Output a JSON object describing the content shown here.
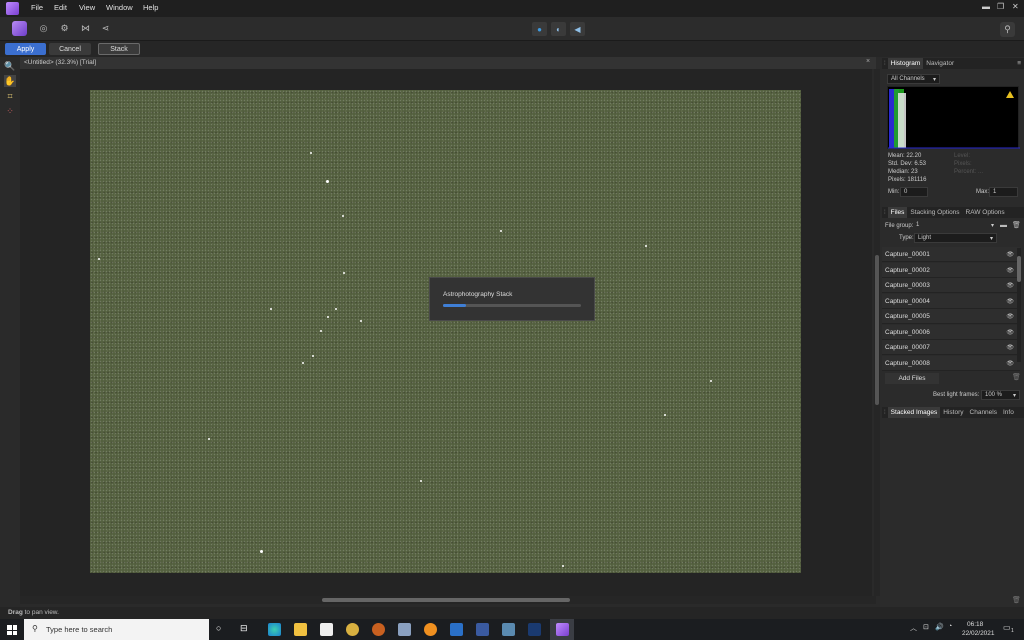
{
  "menu": [
    "File",
    "Edit",
    "View",
    "Window",
    "Help"
  ],
  "window_controls": {
    "minimize": "▬",
    "restore": "❐",
    "close": "✕"
  },
  "context_bar": {
    "apply": "Apply",
    "cancel": "Cancel",
    "stack": "Stack"
  },
  "document": {
    "title": "<Untitled> (32.3%) [Trial]",
    "close": "×"
  },
  "dialog": {
    "title": "Astrophotography Stack",
    "progress": 0.17
  },
  "histogram_panel": {
    "tabs": [
      "Histogram",
      "Navigator"
    ],
    "channel": "All Channels",
    "stats_left": [
      "Mean: 22.20",
      "Std. Dev: 6.53",
      "Median: 23",
      "Pixels: 181116"
    ],
    "stats_right": [
      "Level:",
      "Pixels:",
      "Percent: ..."
    ],
    "min_label": "Min:",
    "min_value": "0",
    "max_label": "Max:",
    "max_value": "1",
    "warning_icon": "warning-triangle-icon"
  },
  "files_panel": {
    "tabs": [
      "Files",
      "Stacking Options",
      "RAW Options"
    ],
    "file_group_label": "File group:",
    "file_group_value": "1",
    "type_label": "Type:",
    "type_value": "Light",
    "files": [
      "Capture_00001",
      "Capture_00002",
      "Capture_00003",
      "Capture_00004",
      "Capture_00005",
      "Capture_00006",
      "Capture_00007",
      "Capture_00008"
    ],
    "add_files": "Add Files",
    "best_light_label": "Best light frames:",
    "best_light_value": "100 %"
  },
  "stacked_panel": {
    "tabs": [
      "Stacked Images",
      "History",
      "Channels",
      "Info"
    ]
  },
  "status": {
    "bold": "Drag",
    "text": " to pan view."
  },
  "taskbar": {
    "search_placeholder": "Type here to search",
    "time": "06:18",
    "date": "22/02/2021",
    "notification_count": "1"
  }
}
